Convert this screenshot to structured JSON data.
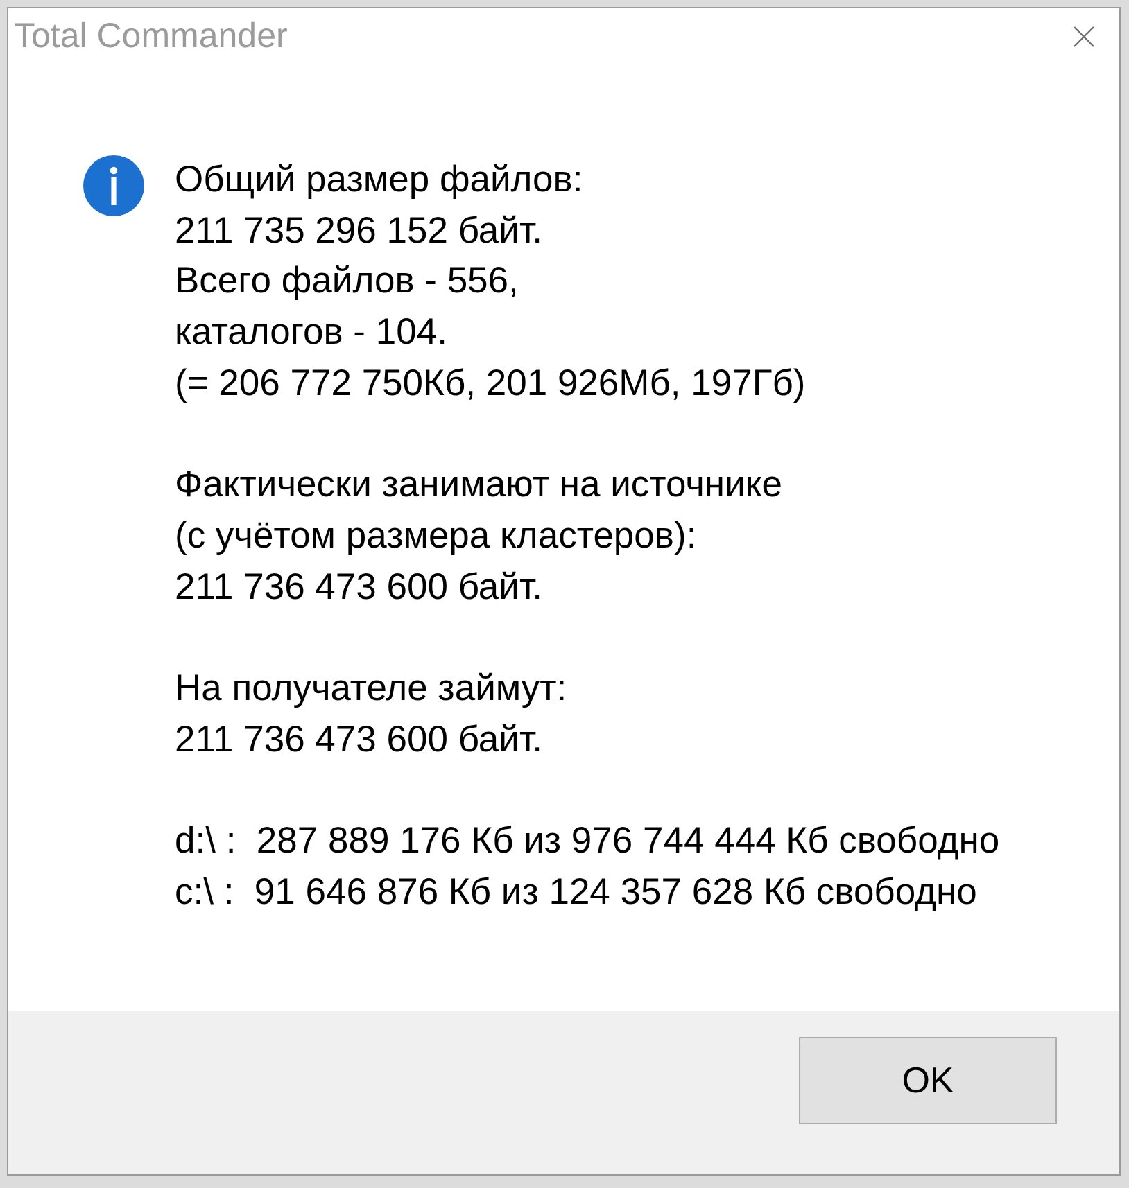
{
  "window": {
    "title": "Total Commander"
  },
  "message": {
    "kind": "info",
    "paragraphs": [
      [
        "Общий размер файлов:",
        "211 735 296 152 байт.",
        "Всего файлов - 556,",
        "каталогов - 104.",
        "(= 206 772 750Кб, 201 926Мб, 197Гб)"
      ],
      [
        "Фактически занимают на источнике",
        "(с учётом размера кластеров):",
        "211 736 473 600 байт."
      ],
      [
        "На получателе займут:",
        "211 736 473 600 байт."
      ],
      [
        "d:\\ :  287 889 176 Кб из 976 744 444 Кб свободно",
        "c:\\ :  91 646 876 Кб из 124 357 628 Кб свободно"
      ]
    ]
  },
  "buttons": [
    {
      "label": "OK"
    }
  ]
}
